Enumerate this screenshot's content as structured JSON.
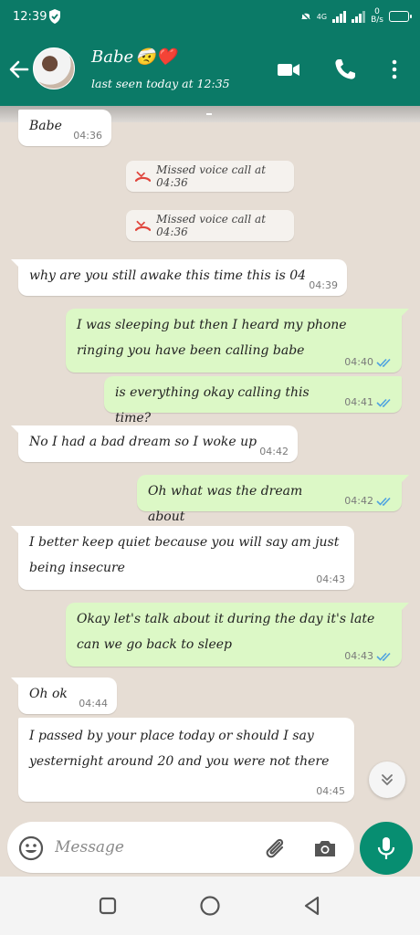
{
  "status_bar": {
    "time": "12:39",
    "network": "4G",
    "speed_value": "0",
    "speed_unit": "B/s",
    "battery_level": 0.85
  },
  "header": {
    "contact_name": "Babe",
    "name_emojis": "🤕❤️",
    "last_seen": "last seen today at 12:35"
  },
  "messages": [
    {
      "type": "in",
      "text": "Babe",
      "time": "04:36"
    },
    {
      "type": "system",
      "text": "Missed voice call at 04:36"
    },
    {
      "type": "system",
      "text": "Missed voice call at 04:36"
    },
    {
      "type": "in",
      "text": "why are you still awake this time this is 04",
      "time": "04:39"
    },
    {
      "type": "out",
      "text": "I was sleeping but then I heard my phone ringing you have been calling babe",
      "time": "04:40"
    },
    {
      "type": "out",
      "text": "is everything okay calling this time?",
      "time": "04:41"
    },
    {
      "type": "in",
      "text": "No I had a bad dream so I woke up",
      "time": "04:42"
    },
    {
      "type": "out",
      "text": "Oh what was the dream about",
      "time": "04:42"
    },
    {
      "type": "in",
      "text": "I better keep quiet because you will say am just being insecure",
      "time": "04:43"
    },
    {
      "type": "out",
      "text": "Okay let's talk about it during the day it's late can we go back to sleep",
      "time": "04:43"
    },
    {
      "type": "in",
      "text": "Oh ok",
      "time": "04:44"
    },
    {
      "type": "in",
      "text": "I passed by your place today or should I say yesternight around 20 and you were not there",
      "time": "04:45"
    }
  ],
  "composer": {
    "placeholder": "Message"
  },
  "colors": {
    "header": "#0b7a67",
    "incoming_bubble": "#ffffff",
    "outgoing_bubble": "#dcf8c6",
    "mic_button": "#078e71",
    "read_tick": "#4fa3e0",
    "missed_call": "#e0453c"
  },
  "icons": {
    "back": "arrow-left-icon",
    "video": "video-camera-icon",
    "call": "phone-icon",
    "menu": "more-vertical-icon",
    "emoji": "smiley-icon",
    "attach": "paperclip-icon",
    "camera": "camera-icon",
    "mic": "microphone-icon"
  }
}
